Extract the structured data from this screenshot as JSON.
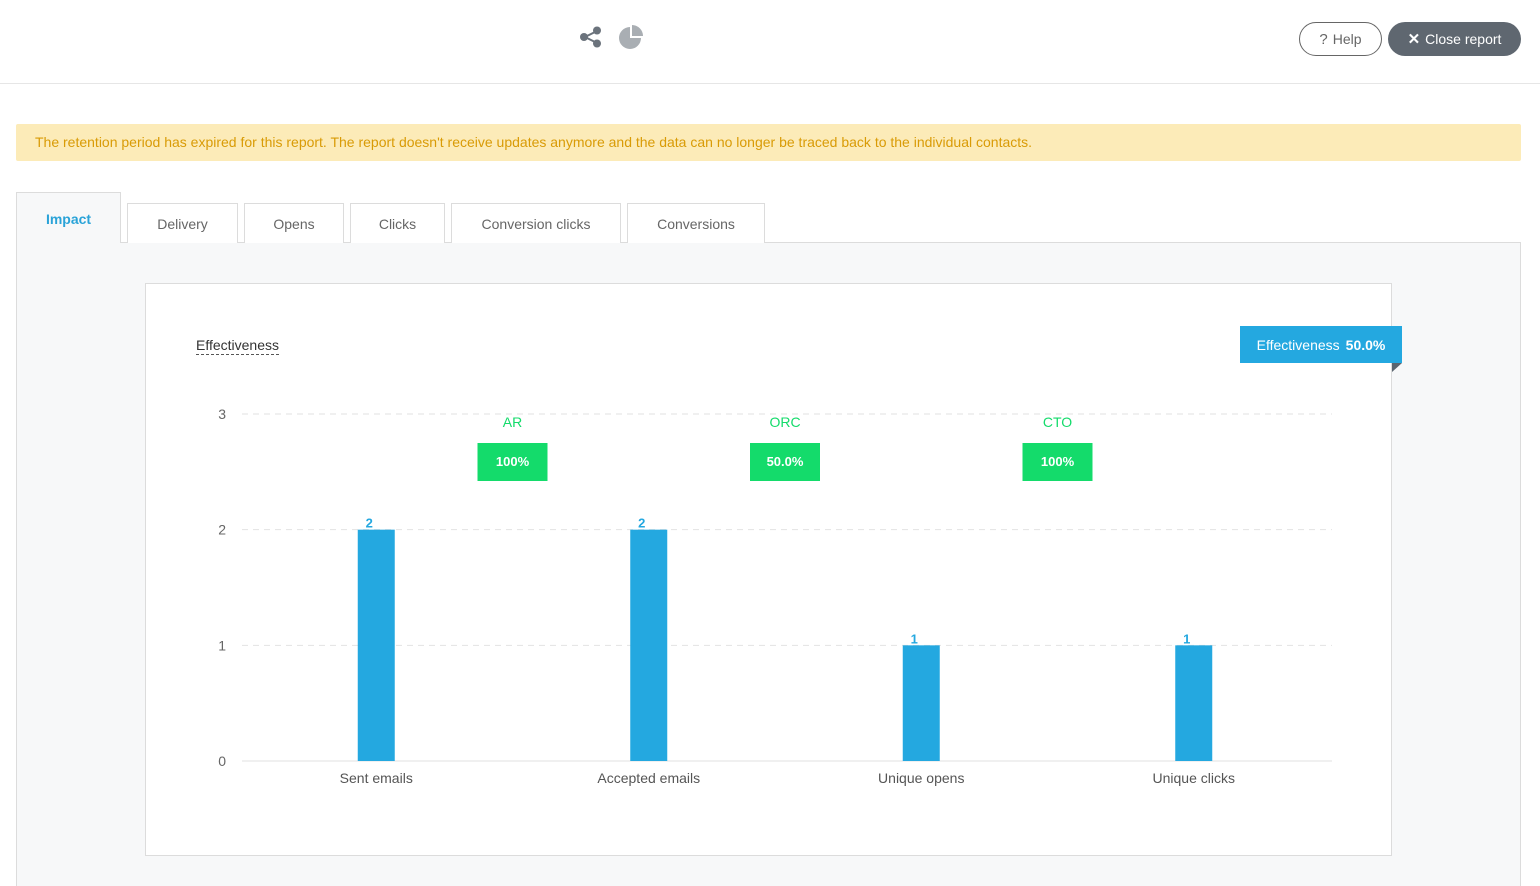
{
  "toolbar": {
    "icons": [
      "share-icon",
      "pie-chart-icon"
    ],
    "help_icon": "?",
    "help_label": "Help",
    "close_icon": "✕",
    "close_label": "Close report"
  },
  "alert": {
    "text": "The retention period has expired for this report. The report doesn't receive updates anymore and the data can no longer be traced back to the individual contacts.",
    "bg_color": "#fcebb8",
    "text_color": "#d99b06"
  },
  "tabs": [
    {
      "label": "Impact",
      "active": true
    },
    {
      "label": "Delivery",
      "active": false
    },
    {
      "label": "Opens",
      "active": false
    },
    {
      "label": "Clicks",
      "active": false
    },
    {
      "label": "Conversion clicks",
      "active": false
    },
    {
      "label": "Conversions",
      "active": false
    }
  ],
  "card": {
    "title": "Effectiveness",
    "badge_label": "Effectiveness",
    "badge_value": "50.0%"
  },
  "chart_data": {
    "type": "bar",
    "categories": [
      "Sent emails",
      "Accepted emails",
      "Unique opens",
      "Unique clicks"
    ],
    "values": [
      2,
      2,
      1,
      1
    ],
    "ylim": [
      0,
      3
    ],
    "yticks": [
      0,
      1,
      2,
      3
    ],
    "grid": true,
    "bar_color": "#24a8e0",
    "ratios": [
      {
        "label": "AR",
        "value": "100%"
      },
      {
        "label": "ORC",
        "value": "50.0%"
      },
      {
        "label": "CTO",
        "value": "100%"
      }
    ],
    "ratio_color": "#14db6b"
  }
}
